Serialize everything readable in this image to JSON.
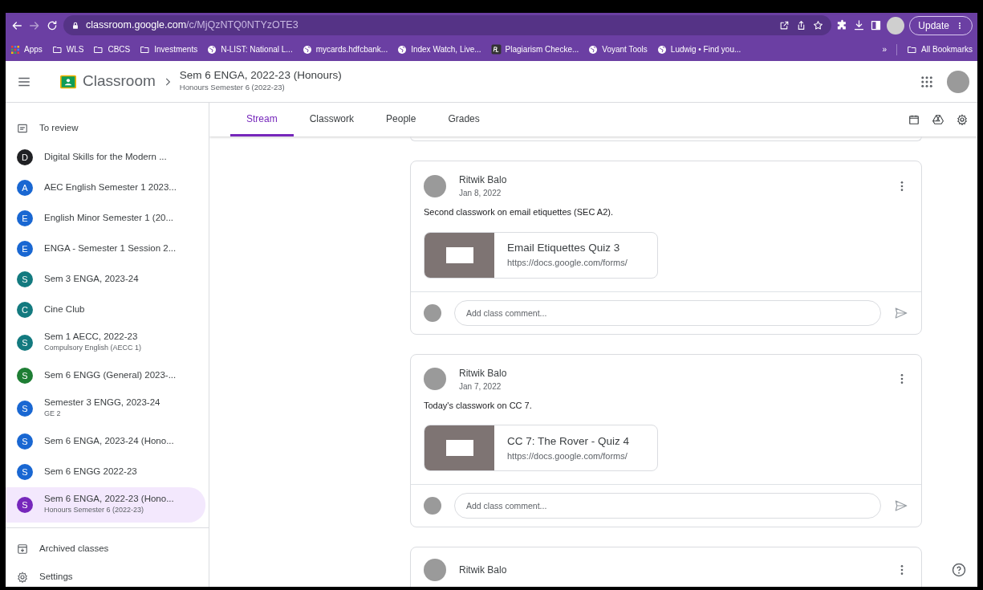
{
  "browser": {
    "url_host": "classroom.google.com",
    "url_path": "/c/MjQzNTQ0NTYzOTE3",
    "update_button": "Update",
    "bookmarks": [
      {
        "kind": "apps",
        "label": "Apps"
      },
      {
        "kind": "folder",
        "label": "WLS"
      },
      {
        "kind": "folder",
        "label": "CBCS"
      },
      {
        "kind": "folder",
        "label": "Investments"
      },
      {
        "kind": "globe",
        "label": "N-LIST: National L..."
      },
      {
        "kind": "globe",
        "label": "mycards.hdfcbank..."
      },
      {
        "kind": "globe",
        "label": "Index Watch, Live..."
      },
      {
        "kind": "pl",
        "label": "Plagiarism Checke..."
      },
      {
        "kind": "globe",
        "label": "Voyant Tools"
      },
      {
        "kind": "globe",
        "label": "Ludwig • Find you..."
      }
    ],
    "overflow": "»",
    "all_bookmarks": "All Bookmarks"
  },
  "header": {
    "app_name": "Classroom",
    "class_title": "Sem 6 ENGA, 2022-23 (Honours)",
    "class_subtitle": "Honours Semester 6 (2022-23)"
  },
  "sidebar": {
    "items": [
      {
        "kind": "nav",
        "label": "To review"
      },
      {
        "kind": "class",
        "letter": "D",
        "name": "Digital Skills for the Modern ...",
        "color": "#202124",
        "selected": false
      },
      {
        "kind": "class",
        "letter": "A",
        "name": "AEC English Semester 1 2023...",
        "color": "#1967d2",
        "selected": false
      },
      {
        "kind": "class",
        "letter": "E",
        "name": "English Minor Semester 1 (20...",
        "color": "#1967d2",
        "selected": false
      },
      {
        "kind": "class",
        "letter": "E",
        "name": "ENGA - Semester 1 Session 2...",
        "color": "#1967d2",
        "selected": false
      },
      {
        "kind": "class",
        "letter": "S",
        "name": "Sem 3 ENGA, 2023-24",
        "color": "#137a7f",
        "selected": false
      },
      {
        "kind": "class",
        "letter": "C",
        "name": "Cine Club",
        "color": "#137a7f",
        "selected": false
      },
      {
        "kind": "class",
        "letter": "S",
        "name": "Sem 1 AECC, 2022-23",
        "subtitle": "Compulsory English (AECC 1)",
        "color": "#137a7f",
        "selected": false
      },
      {
        "kind": "class",
        "letter": "S",
        "name": "Sem 6 ENGG (General) 2023-...",
        "color": "#1e7e34",
        "selected": false
      },
      {
        "kind": "class",
        "letter": "S",
        "name": "Semester 3 ENGG, 2023-24",
        "subtitle": "GE 2",
        "color": "#1967d2",
        "selected": false
      },
      {
        "kind": "class",
        "letter": "S",
        "name": "Sem 6 ENGA, 2023-24 (Hono...",
        "color": "#1967d2",
        "selected": false
      },
      {
        "kind": "class",
        "letter": "S",
        "name": "Sem 6 ENGG 2022-23",
        "color": "#1967d2",
        "selected": false
      },
      {
        "kind": "class",
        "letter": "S",
        "name": "Sem 6 ENGA, 2022-23 (Hono...",
        "subtitle": "Honours Semester 6 (2022-23)",
        "color": "#7627bb",
        "selected": true
      }
    ],
    "footer": [
      {
        "kind": "archive",
        "label": "Archived classes"
      },
      {
        "kind": "settings",
        "label": "Settings"
      }
    ]
  },
  "tabs": [
    {
      "label": "Stream",
      "selected": true
    },
    {
      "label": "Classwork",
      "selected": false
    },
    {
      "label": "People",
      "selected": false
    },
    {
      "label": "Grades",
      "selected": false
    }
  ],
  "posts": [
    {
      "author": "Ritwik Balo",
      "date": "Jan 8, 2022",
      "text": "Second classwork on email etiquettes (SEC A2).",
      "attachment": {
        "title": "Email Etiquettes Quiz 3",
        "url": "https://docs.google.com/forms/"
      },
      "comment_placeholder": "Add class comment..."
    },
    {
      "author": "Ritwik Balo",
      "date": "Jan 7, 2022",
      "text": "Today's classwork on CC 7.",
      "attachment": {
        "title": "CC 7: The Rover - Quiz 4",
        "url": "https://docs.google.com/forms/"
      },
      "comment_placeholder": "Add class comment..."
    },
    {
      "author": "Ritwik Balo"
    }
  ]
}
